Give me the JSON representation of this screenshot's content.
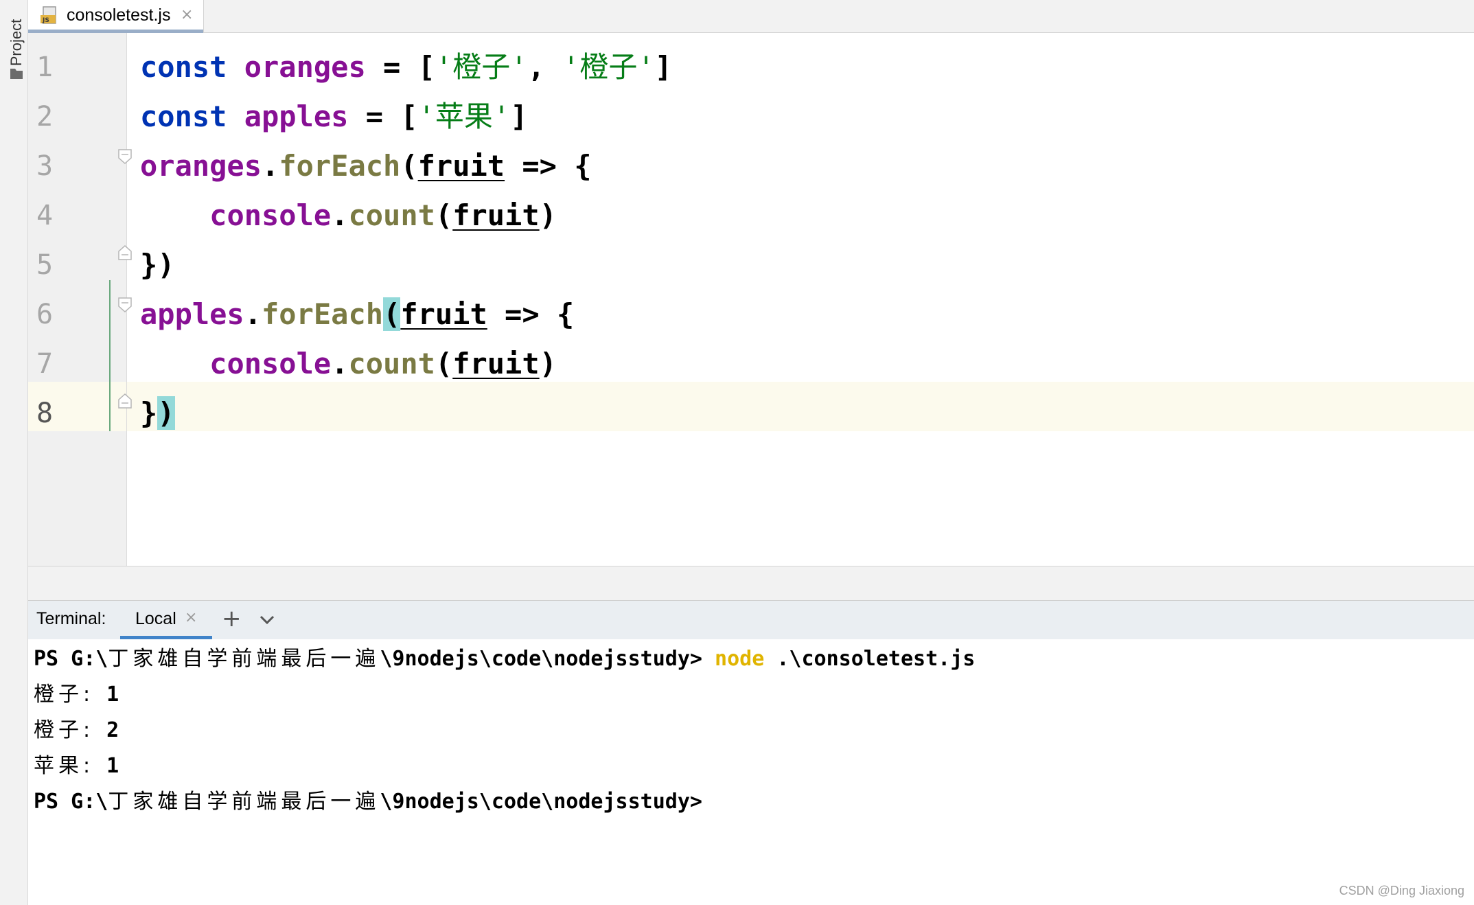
{
  "sidebar": {
    "project_label": "Project"
  },
  "editor_tab": {
    "file_name": "consoletest.js",
    "icon": "js-file-icon",
    "close_glyph": "×"
  },
  "editor": {
    "line_numbers": [
      "1",
      "2",
      "3",
      "4",
      "5",
      "6",
      "7",
      "8"
    ],
    "current_line": "8",
    "lines": {
      "l1": {
        "kw": "const",
        "var": "oranges",
        "op": " = [",
        "s1": "'橙子'",
        "sep": ", ",
        "s2": "'橙子'",
        "close": "]"
      },
      "l2": {
        "kw": "const",
        "var": "apples",
        "op": " = [",
        "s1": "'苹果'",
        "close": "]"
      },
      "l3": {
        "obj": "oranges",
        "dot": ".",
        "method": "forEach",
        "open": "(",
        "param": "fruit",
        "arrow": " => {"
      },
      "l4": {
        "indent": "    ",
        "obj": "console",
        "dot": ".",
        "method": "count",
        "open": "(",
        "param": "fruit",
        "close": ")"
      },
      "l5": {
        "text": "})"
      },
      "l6": {
        "obj": "apples",
        "dot": ".",
        "method": "forEach",
        "open": "(",
        "param": "fruit",
        "arrow": " => {"
      },
      "l7": {
        "indent": "    ",
        "obj": "console",
        "dot": ".",
        "method": "count",
        "open": "(",
        "param": "fruit",
        "close": ")"
      },
      "l8": {
        "brace": "}",
        "paren": ")"
      }
    }
  },
  "terminal": {
    "title": "Terminal:",
    "tab_label": "Local",
    "close_glyph": "×",
    "add_glyph": "+",
    "output": {
      "p1_prefix": "PS G:\\",
      "p1_cjk": "丁家雄自学前端最后一遍",
      "p1_path": "\\9nodejs\\code\\nodejsstudy> ",
      "p1_cmd": "node",
      "p1_arg": " .\\consoletest.js",
      "o1_label": "橙子:",
      "o1_value": " 1",
      "o2_label": "橙子:",
      "o2_value": " 2",
      "o3_label": "苹果:",
      "o3_value": " 1",
      "p2_prefix": "PS G:\\",
      "p2_cjk": "丁家雄自学前端最后一遍",
      "p2_path": "\\9nodejs\\code\\nodejsstudy>"
    }
  },
  "watermark": "CSDN @Ding Jiaxiong",
  "colors": {
    "keyword": "#0033b3",
    "variable": "#871094",
    "method": "#7a7a43",
    "string": "#067d17",
    "node_command": "#e0b400",
    "brace_match": "#93d9d9",
    "caret_line": "#fcfaed"
  }
}
